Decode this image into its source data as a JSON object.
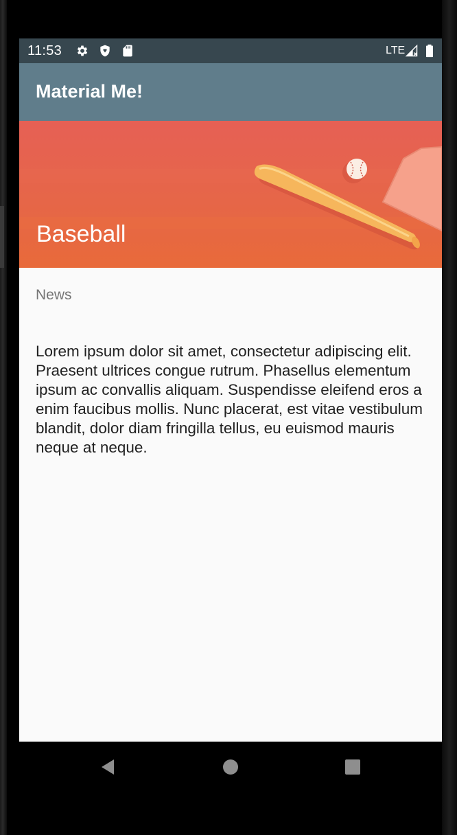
{
  "status_bar": {
    "time": "11:53",
    "network": "LTE",
    "icons": [
      "settings-icon",
      "shield-icon",
      "sd-card-icon",
      "signal-icon",
      "battery-icon"
    ],
    "background": "#37474f"
  },
  "app_bar": {
    "title": "Material Me!",
    "background": "#607d8b"
  },
  "article": {
    "title": "Baseball",
    "subtitle": "News",
    "body": "Lorem ipsum dolor sit amet, consectetur adipiscing elit. Praesent ultrices congue rutrum. Phasellus elementum ipsum ac convallis aliquam. Suspendisse eleifend eros a enim faucibus mollis. Nunc placerat, est vitae vestibulum blandit, dolor diam fringilla tellus, eu euismod mauris neque at neque.",
    "image": "baseball-bat-and-ball-image"
  },
  "nav_bar": {
    "icons": [
      "back-icon",
      "home-icon",
      "recents-icon"
    ]
  }
}
